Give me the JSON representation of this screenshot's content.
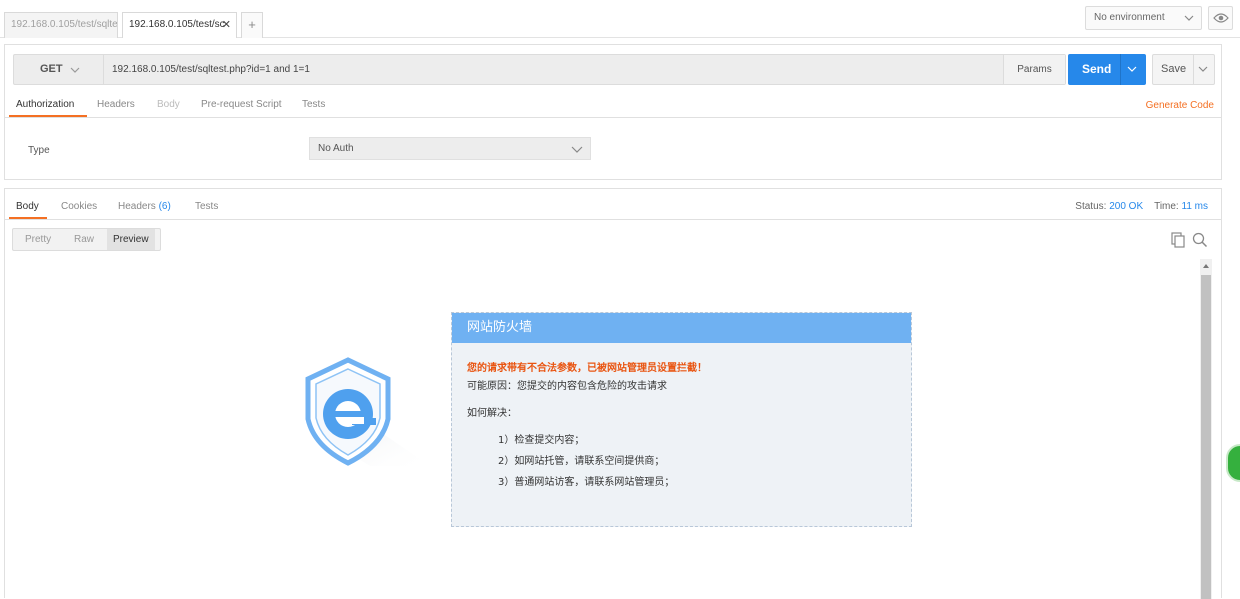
{
  "tabs": [
    {
      "label": "192.168.0.105/test/sqlte"
    },
    {
      "label": "192.168.0.105/test/sc"
    }
  ],
  "tab_close": "✕",
  "tab_add": "+",
  "environment": {
    "selected": "No environment"
  },
  "request": {
    "method": "GET",
    "url": "192.168.0.105/test/sqltest.php?id=1 and 1=1",
    "params_label": "Params",
    "send_label": "Send",
    "save_label": "Save",
    "tabs": [
      "Authorization",
      "Headers",
      "Body",
      "Pre-request Script",
      "Tests"
    ],
    "generate_code": "Generate Code",
    "auth": {
      "type_label": "Type",
      "selected": "No Auth"
    }
  },
  "response": {
    "tabs": {
      "body": "Body",
      "cookies": "Cookies",
      "headers": "Headers",
      "headers_count": "(6)",
      "tests": "Tests"
    },
    "status_label": "Status:",
    "status_value": "200 OK",
    "time_label": "Time:",
    "time_value": "11 ms",
    "view_modes": [
      "Pretty",
      "Raw",
      "Preview"
    ],
    "active_view": "Preview"
  },
  "preview": {
    "title": "网站防火墙",
    "warning": "您的请求带有不合法参数，已被网站管理员设置拦截！",
    "reason": "可能原因：您提交的内容包含危险的攻击请求",
    "how": "如何解决：",
    "steps": [
      "1）检查提交内容；",
      "2）如网站托管，请联系空间提供商；",
      "3）普通网站访客，请联系网站管理员；"
    ]
  },
  "colors": {
    "accent": "#f47023",
    "send": "#2688ea",
    "firewall_header": "#6fb1f2",
    "warning": "#e95410"
  }
}
